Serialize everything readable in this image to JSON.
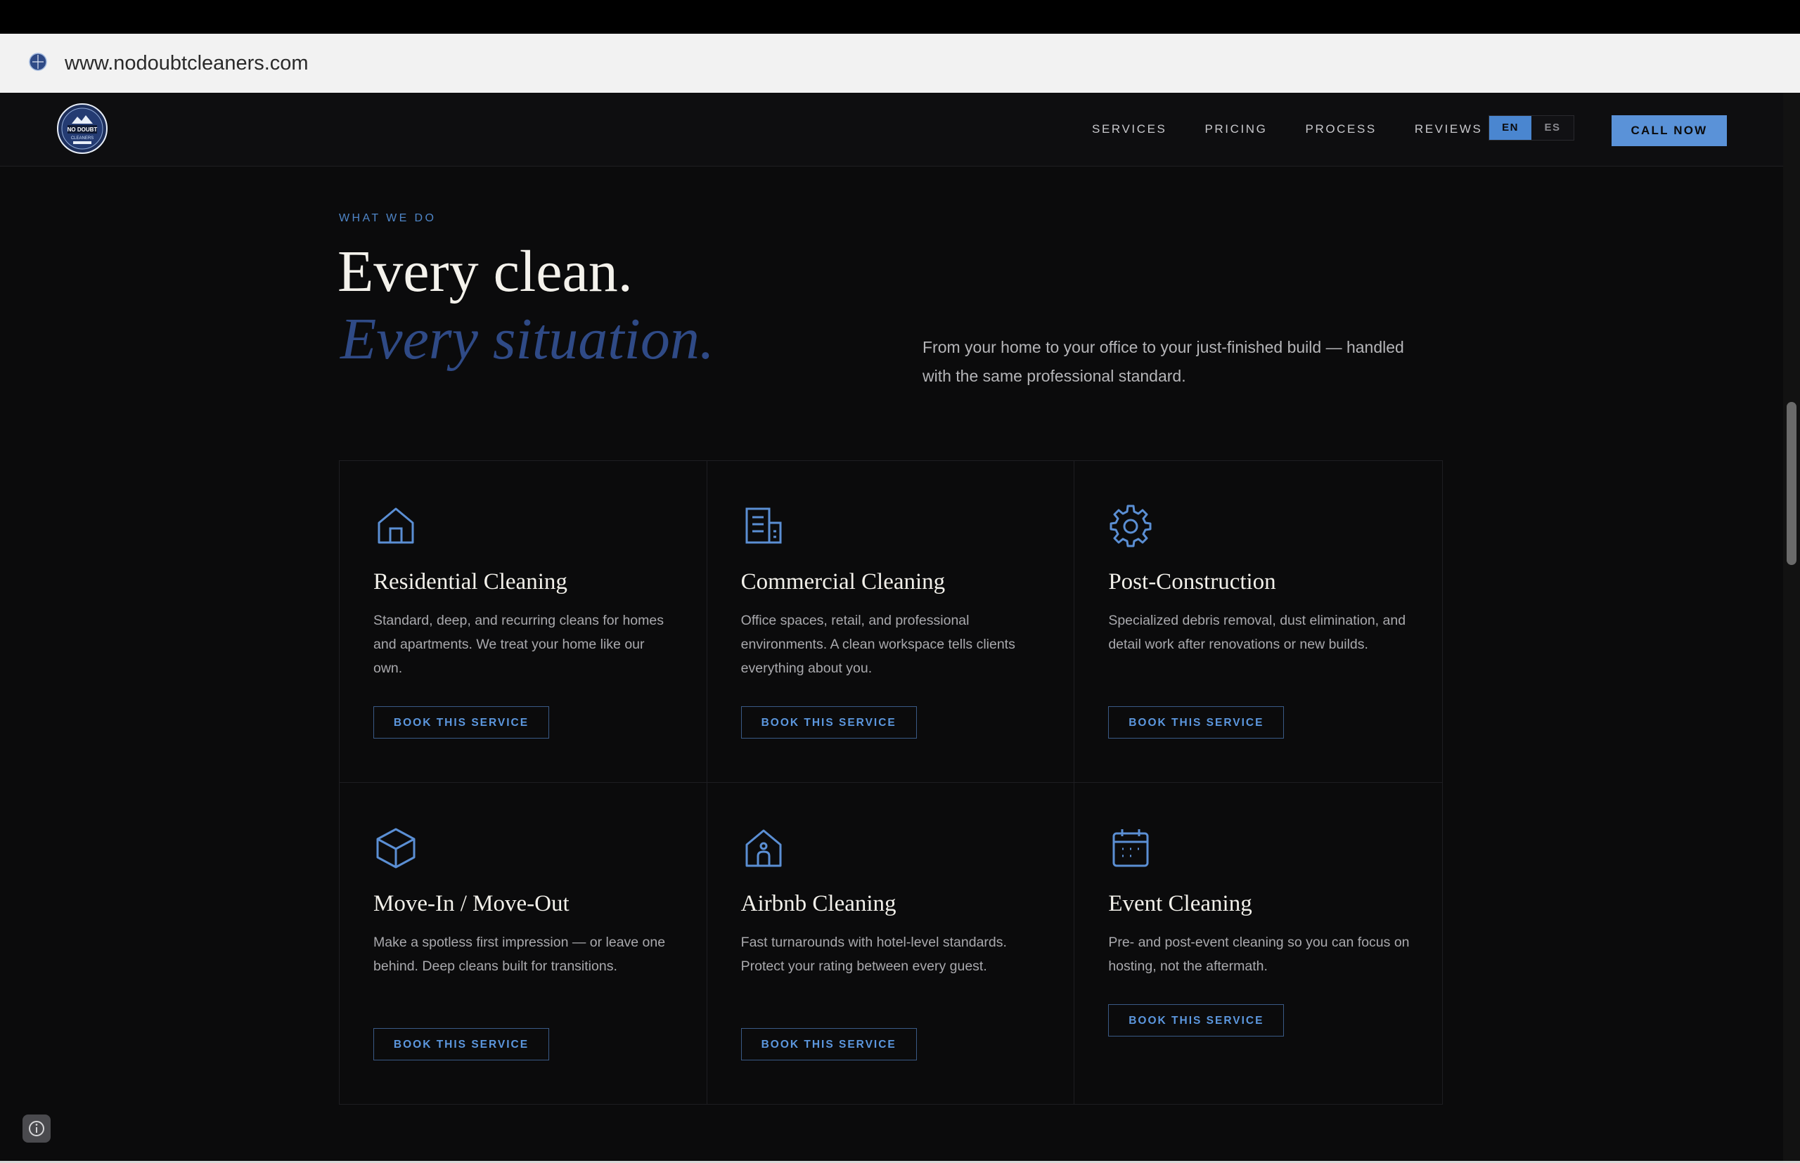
{
  "browser": {
    "url": "www.nodoubtcleaners.com"
  },
  "nav": {
    "logo_text": "NO DOUBT CLEANERS",
    "links": [
      "SERVICES",
      "PRICING",
      "PROCESS",
      "REVIEWS"
    ],
    "lang_en": "EN",
    "lang_es": "ES",
    "call_label": "CALL NOW"
  },
  "hero": {
    "eyebrow": "WHAT WE DO",
    "title_line1": "Every clean.",
    "title_line2": "Every situation.",
    "intro": "From your home to your office to your just-finished build — handled with the same professional standard."
  },
  "services": [
    {
      "icon": "house-icon",
      "title": "Residential Cleaning",
      "desc": "Standard, deep, and recurring cleans for homes and apartments. We treat your home like our own.",
      "button": "BOOK THIS SERVICE"
    },
    {
      "icon": "building-icon",
      "title": "Commercial Cleaning",
      "desc": "Office spaces, retail, and professional environments. A clean workspace tells clients everything about you.",
      "button": "BOOK THIS SERVICE"
    },
    {
      "icon": "gear-icon",
      "title": "Post-Construction",
      "desc": "Specialized debris removal, dust elimination, and detail work after renovations or new builds.",
      "button": "BOOK THIS SERVICE"
    },
    {
      "icon": "box-icon",
      "title": "Move-In / Move-Out",
      "desc": "Make a spotless first impression — or leave one behind. Deep cleans built for transitions.",
      "button": "BOOK THIS SERVICE"
    },
    {
      "icon": "host-house-icon",
      "title": "Airbnb Cleaning",
      "desc": "Fast turnarounds with hotel-level standards. Protect your rating between every guest.",
      "button": "BOOK THIS SERVICE"
    },
    {
      "icon": "calendar-icon",
      "title": "Event Cleaning",
      "desc": "Pre- and post-event cleaning so you can focus on hosting, not the aftermath.",
      "button": "BOOK THIS SERVICE"
    }
  ],
  "colors": {
    "accent": "#5a92d8",
    "background": "#0b0b0c",
    "italic_title": "#2f4a86"
  }
}
